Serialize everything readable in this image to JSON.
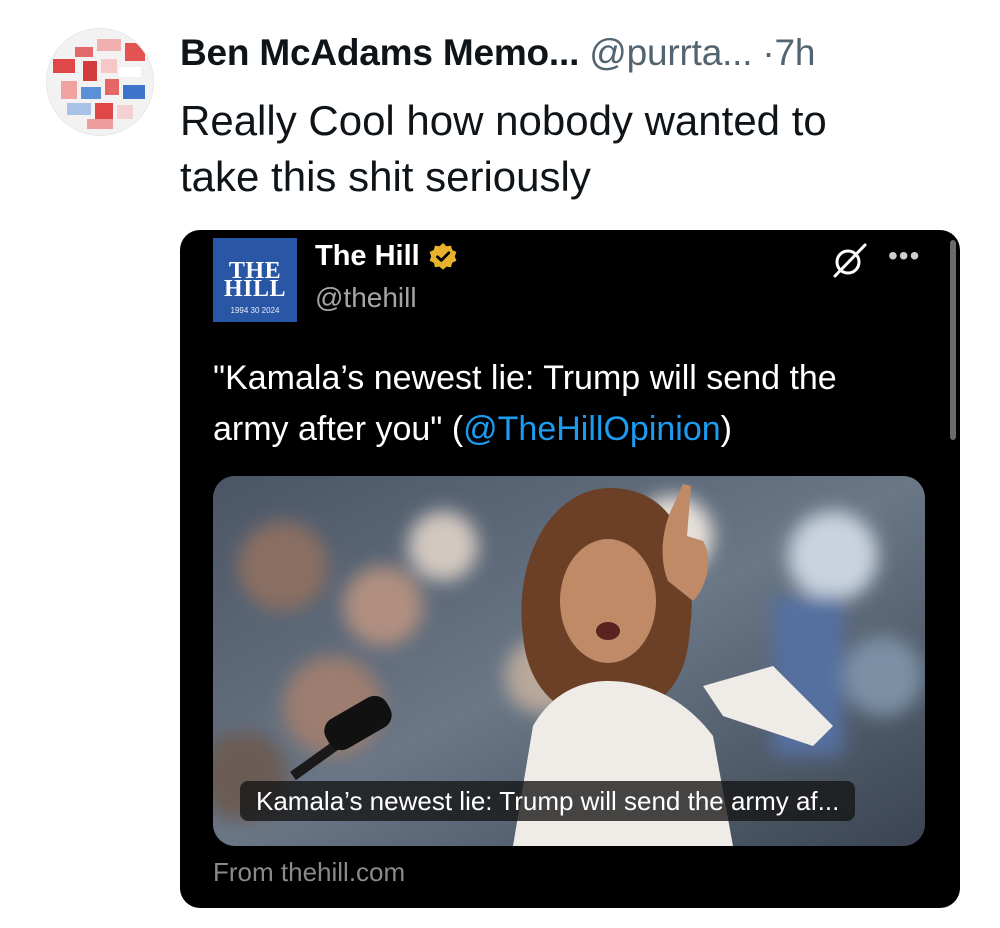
{
  "tweet": {
    "author_name": "Ben McAdams Memo...",
    "handle": "@purrta...",
    "separator": "·",
    "time": "7h",
    "text": "Really Cool how nobody wanted to\ntake this shit seriously"
  },
  "quote": {
    "logo": {
      "line1": "THE",
      "line2": "HILL",
      "years": "1994  30  2024",
      "color": "#2a56a6"
    },
    "name": "The Hill",
    "handle": "@thehill",
    "verified_icon": "verified-badge-icon",
    "text_before_link": "\"Kamala’s newest lie: Trump will send the army after you\" (",
    "link": "@TheHillOpinion",
    "text_after_link": ")",
    "image_caption": "Kamala’s newest lie: Trump will send the army af...",
    "source": "From thehill.com",
    "link_color": "#1d9bf0"
  }
}
